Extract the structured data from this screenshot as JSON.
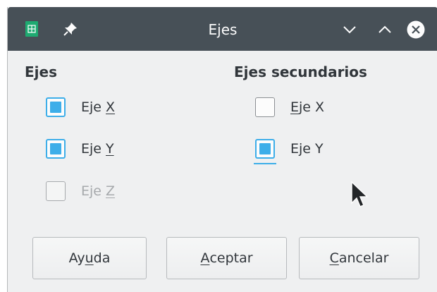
{
  "window": {
    "title": "Ejes",
    "app_icon": "spreadsheet-icon",
    "pin_icon": "pin-icon",
    "controls": [
      "minimize-icon",
      "maximize-icon",
      "close-icon"
    ]
  },
  "axes": {
    "title": "Ejes",
    "x": {
      "prefix": "Eje ",
      "key": "X",
      "checked": true
    },
    "y": {
      "prefix": "Eje ",
      "key": "Y",
      "checked": true
    },
    "z": {
      "prefix": "Eje ",
      "key": "Z",
      "checked": false,
      "disabled": true
    }
  },
  "secondary_axes": {
    "title": "Ejes secundarios",
    "x": {
      "key": "E",
      "suffix": "je X",
      "checked": false
    },
    "y": {
      "label": "Eje Y",
      "checked": true
    }
  },
  "buttons": {
    "help": {
      "pre": "Ay",
      "key": "u",
      "post": "da"
    },
    "ok": {
      "key": "A",
      "post": "ceptar"
    },
    "cancel": {
      "key": "C",
      "post": "ancelar"
    }
  },
  "colors": {
    "titlebar": "#475057",
    "accent": "#3daee9",
    "background": "#eff0f1"
  }
}
